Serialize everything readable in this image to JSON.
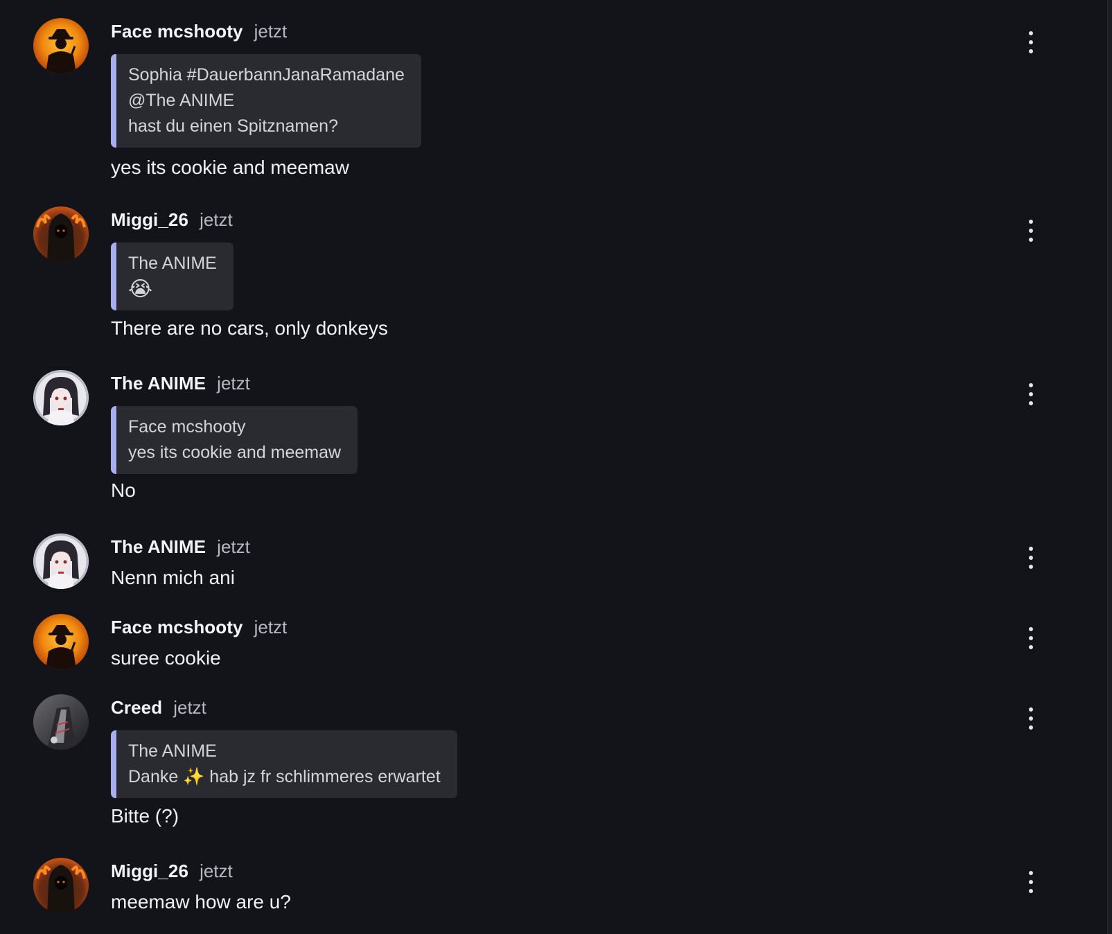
{
  "messages": [
    {
      "author": "Face mcshooty",
      "time": "jetzt",
      "avatar": "cowboy-sunset",
      "quote": {
        "author": "Sophia #DauerbannJanaRamadane",
        "lines": [
          "@The ANIME",
          "hast du einen Spitznamen?"
        ]
      },
      "text": "yes its cookie and meemaw"
    },
    {
      "author": "Miggi_26",
      "time": "jetzt",
      "avatar": "hooded-fire",
      "quote": {
        "author": "The ANIME",
        "lines": [
          "😭"
        ]
      },
      "text": "There are no cars, only donkeys"
    },
    {
      "author": "The ANIME",
      "time": "jetzt",
      "avatar": "anime-girl",
      "quote": {
        "author": "Face mcshooty",
        "lines": [
          "yes its cookie and meemaw"
        ]
      },
      "text": "No"
    },
    {
      "author": "The ANIME",
      "time": "jetzt",
      "avatar": "anime-girl",
      "text": "Nenn mich ani"
    },
    {
      "author": "Face mcshooty",
      "time": "jetzt",
      "avatar": "cowboy-sunset",
      "text": "suree cookie"
    },
    {
      "author": "Creed",
      "time": "jetzt",
      "avatar": "dark-figure",
      "quote": {
        "author": "The ANIME",
        "lines": [
          "Danke ✨ hab jz fr schlimmeres erwartet"
        ]
      },
      "text": "Bitte (?)"
    },
    {
      "author": "Miggi_26",
      "time": "jetzt",
      "avatar": "hooded-fire",
      "text": "meemaw how are u?"
    }
  ],
  "colors": {
    "background": "#121419",
    "quote_bar": "#a7aef2",
    "quote_bg": "#2a2b31"
  },
  "icons": {
    "menu": "more-vertical-icon"
  }
}
